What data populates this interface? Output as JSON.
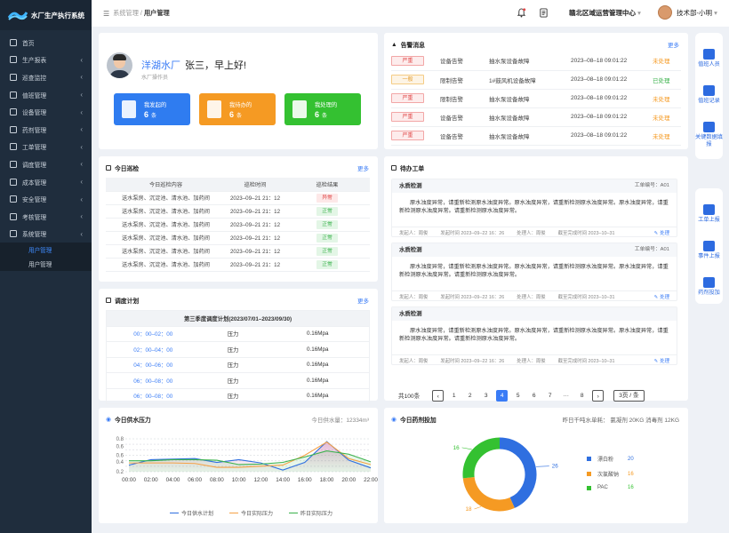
{
  "app": {
    "title": "水厂生产执行系统"
  },
  "sidebar": {
    "items": [
      {
        "label": "首页",
        "arrow": ""
      },
      {
        "label": "生产报表",
        "arrow": "‹"
      },
      {
        "label": "巡查监控",
        "arrow": "‹"
      },
      {
        "label": "值班管理",
        "arrow": "‹"
      },
      {
        "label": "设备管理",
        "arrow": "‹"
      },
      {
        "label": "药剂管理",
        "arrow": "‹"
      },
      {
        "label": "工单管理",
        "arrow": "‹"
      },
      {
        "label": "调度管理",
        "arrow": "‹"
      },
      {
        "label": "成本管理",
        "arrow": "‹"
      },
      {
        "label": "安全管理",
        "arrow": "‹"
      },
      {
        "label": "考核管理",
        "arrow": "‹"
      },
      {
        "label": "系统管理",
        "arrow": "‹"
      }
    ],
    "sub": [
      "用户管理",
      "用户管理"
    ]
  },
  "header": {
    "crumb_parent": "系统管理",
    "crumb_sep": " / ",
    "crumb_current": "用户管理",
    "region": "赣北区域运营管理中心",
    "region_caret": "▾",
    "user": "技术部-小明",
    "user_caret": "▾"
  },
  "welcome": {
    "factory": "洋湖水厂",
    "greeting": "张三，早上好!",
    "role": "水厂操作员",
    "stats": [
      {
        "label": "我发起的",
        "value": "6",
        "unit": "条",
        "color": "#2f7cf0"
      },
      {
        "label": "我待办的",
        "value": "6",
        "unit": "条",
        "color": "#f59a23"
      },
      {
        "label": "我处理的",
        "value": "6",
        "unit": "条",
        "color": "#34c131"
      }
    ]
  },
  "alarms": {
    "title": "告警消息",
    "more": "更多",
    "rows": [
      {
        "level": "严重",
        "type": "设备告警",
        "desc": "抽水泵设备故障",
        "time": "2023–08–18 09:01:22",
        "status": "未处理",
        "lv": "red",
        "sc": "#f59a23"
      },
      {
        "level": "一般",
        "type": "限制告警",
        "desc": "1#鼓风机设备故障",
        "time": "2023–08–18 09:01:22",
        "status": "已处理",
        "lv": "orange",
        "sc": "#3bb24c"
      },
      {
        "level": "严重",
        "type": "限制告警",
        "desc": "抽水泵设备故障",
        "time": "2023–08–18 09:01:22",
        "status": "未处理",
        "lv": "red",
        "sc": "#f59a23"
      },
      {
        "level": "严重",
        "type": "设备告警",
        "desc": "抽水泵设备故障",
        "time": "2023–08–18 09:01:22",
        "status": "未处理",
        "lv": "red",
        "sc": "#f59a23"
      },
      {
        "level": "严重",
        "type": "设备告警",
        "desc": "抽水泵设备故障",
        "time": "2023–08–18 09:01:22",
        "status": "未处理",
        "lv": "red",
        "sc": "#f59a23"
      }
    ]
  },
  "patrol": {
    "title": "今日巡检",
    "more": "更多",
    "headers": [
      "今日巡检内容",
      "巡检时间",
      "巡检结果"
    ],
    "rows": [
      {
        "content": "送水泵房、沉淀池、清水池、加药间",
        "time": "2023–09–21 21：12",
        "result": "异常",
        "cls": "ab"
      },
      {
        "content": "送水泵房、沉淀池、清水池、加药间",
        "time": "2023–09–21 21：12",
        "result": "正常",
        "cls": "ok"
      },
      {
        "content": "送水泵房、沉淀池、清水池、加药间",
        "time": "2023–09–21 21：12",
        "result": "正常",
        "cls": "ok"
      },
      {
        "content": "送水泵房、沉淀池、清水池、加药间",
        "time": "2023–09–21 21：12",
        "result": "正常",
        "cls": "ok"
      },
      {
        "content": "送水泵房、沉淀池、清水池、加药间",
        "time": "2023–09–21 21：12",
        "result": "正常",
        "cls": "ok"
      },
      {
        "content": "送水泵房、沉淀池、清水池、加药间",
        "time": "2023–09–21 21：12",
        "result": "正常",
        "cls": "ok"
      }
    ]
  },
  "plan": {
    "title": "调度计划",
    "more": "更多",
    "header": "第三季度调度计划(2023/07/01–2023/09/30)",
    "rows": [
      {
        "time": "00：00–02：00",
        "item": "压力",
        "value": "0.16Mpa"
      },
      {
        "time": "02：00–04：00",
        "item": "压力",
        "value": "0.16Mpa"
      },
      {
        "time": "04：00–06：00",
        "item": "压力",
        "value": "0.16Mpa"
      },
      {
        "time": "06：00–08：00",
        "item": "压力",
        "value": "0.16Mpa"
      },
      {
        "time": "06：00–08：00",
        "item": "压力",
        "value": "0.16Mpa"
      }
    ]
  },
  "workorders": {
    "title": "待办工单",
    "items": [
      {
        "title": "水质检测",
        "no": "工单编号：A01",
        "body": "原水浊度异常，请重新检测原水浊度异常。原水浊度异常，请重新检测原水浊度异常。原水浊度异常，请重新检测原水浊度异常。请重新检测原水浊度异常。",
        "sender": "发起人：周俊",
        "stime": "发起时间 2023–09–22 16：26",
        "handler": "处理人：周俊",
        "deadline": "截至完成时间 2023–10–31",
        "action": "处理"
      },
      {
        "title": "水质检测",
        "no": "工单编号：A01",
        "body": "原水浊度异常，请重新检测原水浊度异常。原水浊度异常，请重新检测原水浊度异常。原水浊度异常，请重新检测原水浊度异常。请重新检测原水浊度异常。",
        "sender": "发起人：周俊",
        "stime": "发起时间 2023–09–22 16：26",
        "handler": "处理人：周俊",
        "deadline": "截至完成时间 2023–10–31",
        "action": "处理"
      },
      {
        "title": "水质检测",
        "no": "",
        "body": "原水浊度异常，请重新检测原水浊度异常。原水浊度异常，请重新检测原水浊度异常。原水浊度异常，请重新检测原水浊度异常。请重新检测原水浊度异常。",
        "sender": "发起人：周俊",
        "stime": "发起时间 2023–09–22 16：26",
        "handler": "处理人：周俊",
        "deadline": "截至完成时间 2023–10–31",
        "action": "处理"
      }
    ]
  },
  "pager": {
    "total": "共100条",
    "prev": "‹",
    "next": "›",
    "pages": [
      "1",
      "2",
      "3",
      "4",
      "5",
      "6",
      "7",
      "···",
      "8"
    ],
    "current": "4",
    "size": "3页 / 条"
  },
  "right_bar": {
    "group1": [
      "值班人员",
      "值班记录",
      "关键数据填报"
    ],
    "group2": [
      "工单上报",
      "事件上报",
      "药剂投加"
    ]
  },
  "chart_data": [
    {
      "type": "line",
      "title": "今日供水压力",
      "subtitle": "今日供水量：12334m³",
      "x": [
        "00:00",
        "02:00",
        "04:00",
        "06:00",
        "08:00",
        "10:00",
        "12:00",
        "14:00",
        "16:00",
        "18:00",
        "20:00",
        "22:00"
      ],
      "ylim": [
        0.2,
        0.8
      ],
      "yticks": [
        "0.2",
        "0.4",
        "0.6",
        "0.8"
      ],
      "y_ticks_extra": [
        "0.4",
        "0.6"
      ],
      "series": [
        {
          "name": "今日供水计划",
          "color": "#2f6fe0",
          "values": [
            0.32,
            0.42,
            0.43,
            0.44,
            0.37,
            0.42,
            0.36,
            0.23,
            0.37,
            0.75,
            0.41,
            0.27
          ]
        },
        {
          "name": "今日实际压力",
          "color": "#f5a146",
          "values": [
            0.36,
            0.36,
            0.36,
            0.35,
            0.28,
            0.28,
            0.3,
            0.32,
            0.5,
            0.74,
            0.44,
            0.33
          ]
        },
        {
          "name": "昨日实际压力",
          "color": "#3bb24c",
          "values": [
            0.4,
            0.4,
            0.42,
            0.42,
            0.41,
            0.33,
            0.34,
            0.37,
            0.47,
            0.58,
            0.52,
            0.38
          ]
        }
      ]
    },
    {
      "type": "pie",
      "title": "今日药剂投加",
      "subtitle": "昨日千吨水单耗：   氯凝剂 20KG  消毒剂 12KG",
      "slices": [
        {
          "name": "漂白粉",
          "value": 26,
          "color": "#2f6fe0",
          "legend_value": "20"
        },
        {
          "name": "次氯酸钠",
          "value": 18,
          "color": "#f59a23",
          "legend_value": "16"
        },
        {
          "name": "PAC",
          "value": 16,
          "color": "#34c131",
          "legend_value": "16"
        }
      ]
    }
  ]
}
